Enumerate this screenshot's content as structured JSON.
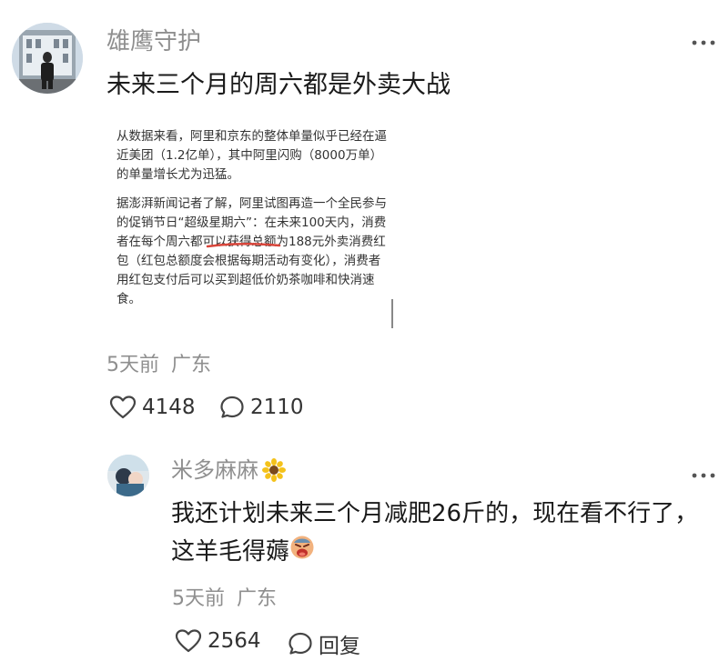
{
  "post": {
    "username": "雄鹰守护",
    "text": "未来三个月的周六都是外卖大战",
    "quote": {
      "p1": "从数据来看，阿里和京东的整体单量似乎已经在逼近美团（1.2亿单），其中阿里闪购（8000万单）的单量增长尤为迅猛。",
      "p2_a": "据澎湃新闻记者了解，阿里试图再造一个全民参与的促销节日",
      "p2_highlight": "“超级星期六”",
      "p2_b": "：在未来100天内，消费者在每个周六都可以获得总额为188元外卖消费红包（红包总额度会根据每期活动有变化），消费者用红包支付后可以买到超低价奶茶咖啡和快消速食。"
    },
    "time": "5天前",
    "location": "广东",
    "likes": "4148",
    "comments": "2110",
    "more_icon": "more-dots-icon"
  },
  "reply": {
    "username": "米多麻麻",
    "name_emoji": "sunflower-icon",
    "text": "我还计划未来三个月减肥26斤的，现在看不行了，这羊毛得薅",
    "text_emoji": "crying-face-icon",
    "time": "5天前",
    "location": "广东",
    "likes": "2564",
    "reply_label": "回复"
  },
  "colors": {
    "meta_gray": "#8f8f8f",
    "highlight_red": "#d9453a"
  }
}
